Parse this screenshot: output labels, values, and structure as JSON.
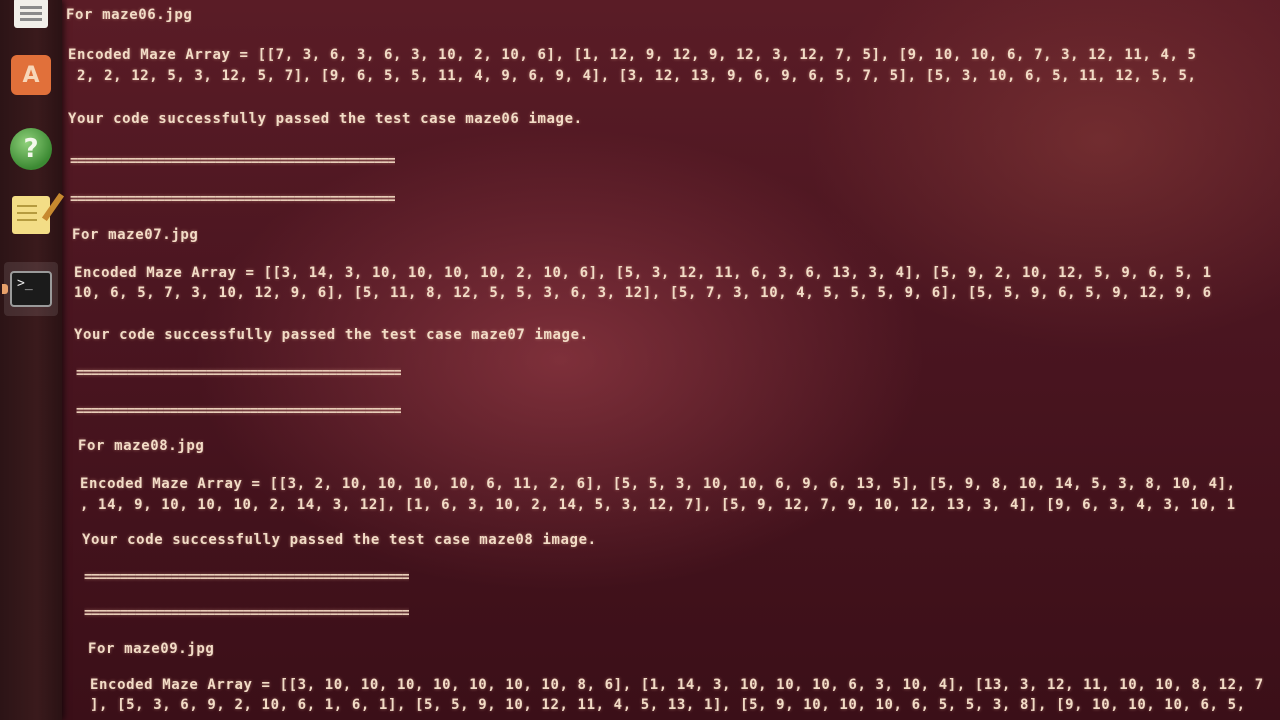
{
  "launcher": {
    "items": [
      {
        "name": "files-icon",
        "label": ""
      },
      {
        "name": "software-store-icon",
        "label": "A"
      },
      {
        "name": "help-icon",
        "label": "?"
      },
      {
        "name": "notes-icon",
        "label": ""
      },
      {
        "name": "terminal-icon",
        "label": ">_"
      }
    ]
  },
  "terminal": {
    "blocks": [
      {
        "header": "For maze06.jpg",
        "array_line1": "Encoded Maze Array = [[7, 3, 6, 3, 6, 3, 10, 2, 10, 6], [1, 12, 9, 12, 9, 12, 3, 12, 7, 5], [9, 10, 10, 6, 7, 3, 12, 11, 4, 5",
        "array_line2": " 2, 2, 12, 5, 3, 12, 5, 7], [9, 6, 5, 5, 11, 4, 9, 6, 9, 4], [3, 12, 13, 9, 6, 9, 6, 5, 7, 5], [5, 3, 10, 6, 5, 11, 12, 5, 5,",
        "result": "Your code successfully passed the test case maze06 image.",
        "sep1": "=============================================",
        "sep2": "============================================="
      },
      {
        "header": "For maze07.jpg",
        "array_line1": "Encoded Maze Array = [[3, 14, 3, 10, 10, 10, 10, 2, 10, 6], [5, 3, 12, 11, 6, 3, 6, 13, 3, 4], [5, 9, 2, 10, 12, 5, 9, 6, 5, 1",
        "array_line2": "10, 6, 5, 7, 3, 10, 12, 9, 6], [5, 11, 8, 12, 5, 5, 3, 6, 3, 12], [5, 7, 3, 10, 4, 5, 5, 5, 9, 6], [5, 5, 9, 6, 5, 9, 12, 9, 6",
        "result": "Your code successfully passed the test case maze07 image.",
        "sep1": "=============================================",
        "sep2": "============================================="
      },
      {
        "header": "For maze08.jpg",
        "array_line1": "Encoded Maze Array = [[3, 2, 10, 10, 10, 10, 6, 11, 2, 6], [5, 5, 3, 10, 10, 6, 9, 6, 13, 5], [5, 9, 8, 10, 14, 5, 3, 8, 10, 4],",
        "array_line2": ", 14, 9, 10, 10, 10, 2, 14, 3, 12], [1, 6, 3, 10, 2, 14, 5, 3, 12, 7], [5, 9, 12, 7, 9, 10, 12, 13, 3, 4], [9, 6, 3, 4, 3, 10, 1",
        "result": "Your code successfully passed the test case maze08 image.",
        "sep1": "=============================================",
        "sep2": "============================================="
      },
      {
        "header": "For maze09.jpg",
        "array_line1": "Encoded Maze Array = [[3, 10, 10, 10, 10, 10, 10, 10, 8, 6], [1, 14, 3, 10, 10, 10, 6, 3, 10, 4], [13, 3, 12, 11, 10, 10, 8, 12, 7",
        "array_line2": "], [5, 3, 6, 9, 2, 10, 6, 1, 6, 1], [5, 5, 9, 10, 12, 11, 4, 5, 13, 1], [5, 9, 10, 10, 10, 6, 5, 5, 3, 8], [9, 10, 10, 10, 6, 5,"
      }
    ]
  }
}
